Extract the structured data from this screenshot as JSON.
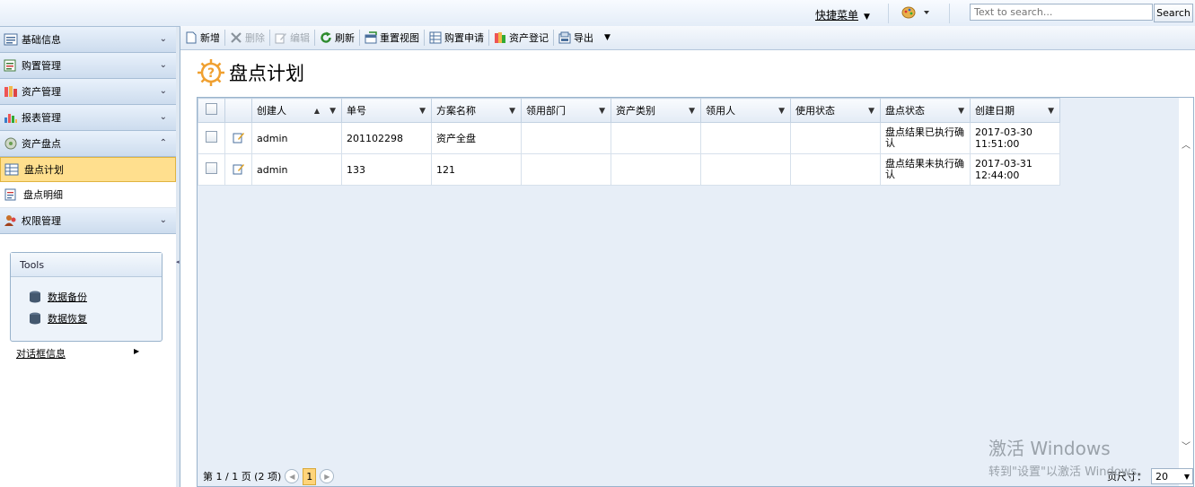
{
  "topbar": {
    "quick_menu": "快捷菜单",
    "search_placeholder": "Text to search...",
    "search_button": "Search"
  },
  "sidebar": {
    "sections": [
      {
        "label": "基础信息",
        "icon": "form-icon"
      },
      {
        "label": "购置管理",
        "icon": "cart-list-icon"
      },
      {
        "label": "资产管理",
        "icon": "asset-icon"
      },
      {
        "label": "报表管理",
        "icon": "bar-chart-icon"
      }
    ],
    "inventory": {
      "label": "资产盘点",
      "items": [
        {
          "label": "盘点计划",
          "active": true
        },
        {
          "label": "盘点明细",
          "active": false
        }
      ]
    },
    "permissions": {
      "label": "权限管理"
    },
    "tools": {
      "title": "Tools",
      "links": [
        {
          "label": "数据备份"
        },
        {
          "label": "数据恢复"
        }
      ]
    },
    "dialog_info": "对话框信息"
  },
  "toolbar": {
    "buttons": [
      {
        "label": "新增",
        "enabled": true
      },
      {
        "label": "删除",
        "enabled": false
      },
      {
        "label": "编辑",
        "enabled": false
      },
      {
        "label": "刷新",
        "enabled": true
      },
      {
        "label": "重置视图",
        "enabled": true
      },
      {
        "label": "购置申请",
        "enabled": true
      },
      {
        "label": "资产登记",
        "enabled": true
      },
      {
        "label": "导出",
        "enabled": true
      }
    ]
  },
  "page": {
    "title": "盘点计划"
  },
  "grid": {
    "columns": [
      "创建人",
      "单号",
      "方案名称",
      "领用部门",
      "资产类别",
      "领用人",
      "使用状态",
      "盘点状态",
      "创建日期"
    ],
    "rows": [
      {
        "creator": "admin",
        "number": "201102298",
        "plan": "资产全盘",
        "dept": "",
        "category": "",
        "user": "",
        "usage": "",
        "status": "盘点结果已执行确认",
        "date": "2017-03-30",
        "time": "11:51:00"
      },
      {
        "creator": "admin",
        "number": "133",
        "plan": "121",
        "dept": "",
        "category": "",
        "user": "",
        "usage": "",
        "status": "盘点结果未执行确认",
        "date": "2017-03-31",
        "time": "12:44:00"
      }
    ],
    "pager": {
      "info": "第 1 / 1 页 (2 项)",
      "current_page": "1",
      "page_size_label": "页尺寸：",
      "page_size": "20"
    }
  },
  "watermark": {
    "line1": "激活 Windows",
    "line2": "转到\"设置\"以激活 Windows。"
  }
}
